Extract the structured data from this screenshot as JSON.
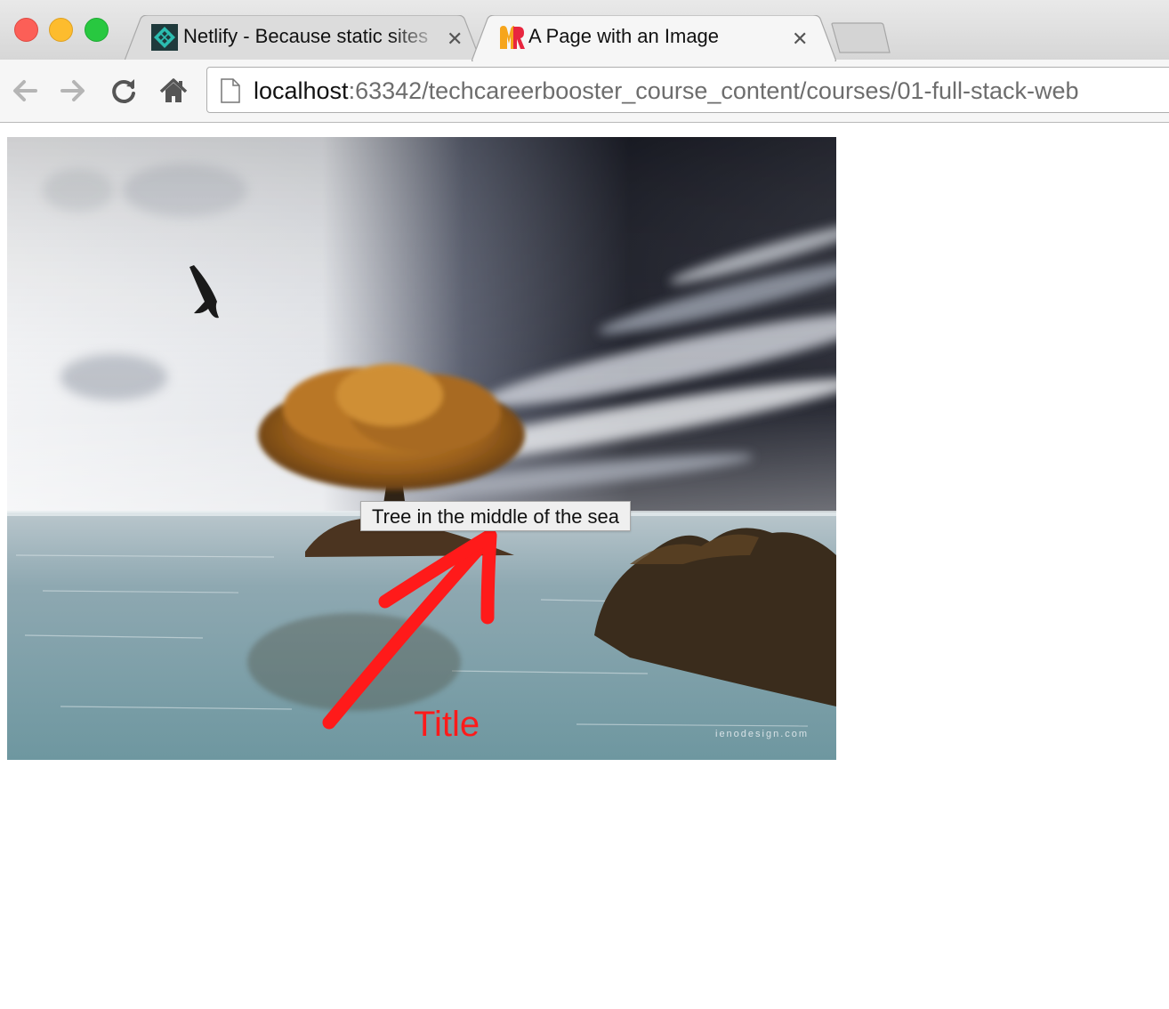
{
  "window": {
    "traffic_lights": {
      "close": "#fc5f57",
      "minimize": "#fdbc2e",
      "maximize": "#28c840"
    }
  },
  "tabs": [
    {
      "title": "Netlify - Because static sites",
      "favicon": "netlify-icon",
      "active": false
    },
    {
      "title": "A Page with an Image",
      "favicon": "mr-logo-icon",
      "active": true
    }
  ],
  "toolbar": {
    "back": "back-arrow-icon",
    "forward": "forward-arrow-icon",
    "reload": "reload-icon",
    "home": "home-icon"
  },
  "address_bar": {
    "host": "localhost",
    "rest": ":63342/techcareerbooster_course_content/courses/01-full-stack-web"
  },
  "page": {
    "image_tooltip": "Tree in the middle of the sea",
    "watermark": "ienodesign.com",
    "annotation_label": "Title",
    "annotation_color": "#ff1a1a"
  }
}
